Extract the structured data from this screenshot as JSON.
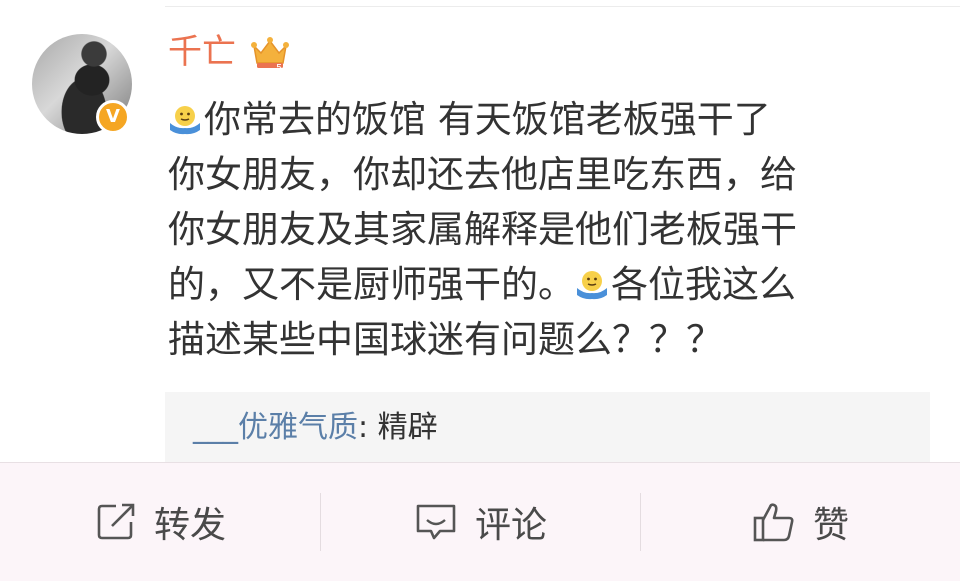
{
  "post": {
    "username": "千亡",
    "text_lines": [
      "你常去的饭馆 有天饭馆老板强干了",
      "你女朋友，你却还去他店里吃东西，给",
      "你女朋友及其家属解释是他们老板强干",
      "的，又不是厨师强干的。",
      "各位我这么",
      "描述某些中国球迷有问题么？？？"
    ]
  },
  "comment": {
    "user": "___优雅气质",
    "separator": ":",
    "text": "精辟"
  },
  "actions": {
    "repost": "转发",
    "comment": "评论",
    "like": "赞"
  },
  "colors": {
    "username": "#eb7350",
    "link": "#5b7fa8",
    "verified": "#f5a623",
    "text": "#333333"
  },
  "icons": [
    "verified-badge-icon",
    "crown-badge-icon",
    "shrug-emoji-icon",
    "repost-icon",
    "comment-icon",
    "like-icon"
  ]
}
